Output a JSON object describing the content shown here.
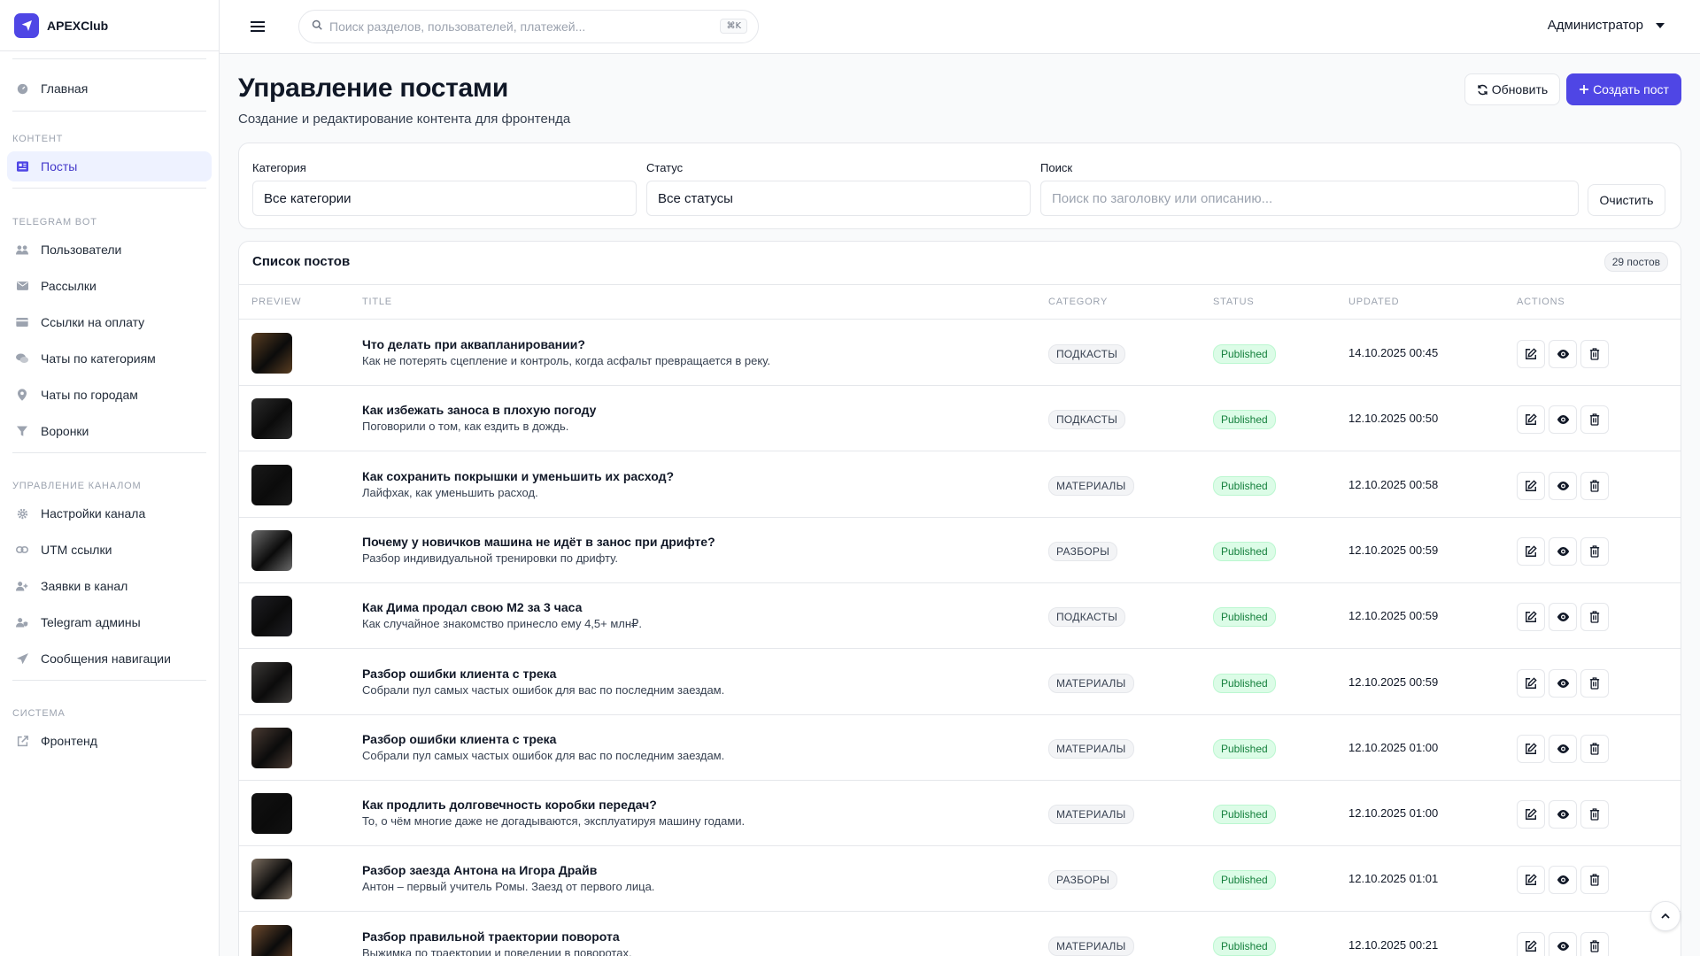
{
  "brand": {
    "name": "APEXClub",
    "icon": "rocket-icon",
    "accent": "#4f46e5"
  },
  "sidebar": {
    "home": {
      "label": "Главная",
      "icon": "dashboard-icon"
    },
    "sections": [
      {
        "title": "Контент",
        "items": [
          {
            "label": "Посты",
            "icon": "posts-icon",
            "active": true
          }
        ]
      },
      {
        "title": "Telegram Bot",
        "items": [
          {
            "label": "Пользователи",
            "icon": "users-icon"
          },
          {
            "label": "Рассылки",
            "icon": "mail-icon"
          },
          {
            "label": "Ссылки на оплату",
            "icon": "credit-card-icon"
          },
          {
            "label": "Чаты по категориям",
            "icon": "chats-icon"
          },
          {
            "label": "Чаты по городам",
            "icon": "location-pin-icon"
          },
          {
            "label": "Воронки",
            "icon": "funnel-icon"
          }
        ]
      },
      {
        "title": "Управление каналом",
        "items": [
          {
            "label": "Настройки канала",
            "icon": "gear-icon"
          },
          {
            "label": "UTM ссылки",
            "icon": "link-icon"
          },
          {
            "label": "Заявки в канал",
            "icon": "user-plus-icon"
          },
          {
            "label": "Telegram админы",
            "icon": "user-shield-icon"
          },
          {
            "label": "Сообщения навигации",
            "icon": "send-icon"
          }
        ]
      },
      {
        "title": "Система",
        "items": [
          {
            "label": "Фронтенд",
            "icon": "external-link-icon"
          }
        ]
      }
    ]
  },
  "topbar": {
    "search_placeholder": "Поиск разделов, пользователей, платежей...",
    "shortcut": "⌘K",
    "user_label": "Администратор"
  },
  "page": {
    "title": "Управление постами",
    "subtitle": "Создание и редактирование контента для фронтенда",
    "refresh_label": "Обновить",
    "create_label": "Создать пост"
  },
  "filters": {
    "category_label": "Категория",
    "category_value": "Все категории",
    "status_label": "Статус",
    "status_value": "Все статусы",
    "search_label": "Поиск",
    "search_placeholder": "Поиск по заголовку или описанию...",
    "clear_label": "Очистить"
  },
  "list": {
    "title": "Список постов",
    "count": "29 постов",
    "columns": [
      "Preview",
      "Title",
      "Category",
      "Status",
      "Updated",
      "Actions"
    ],
    "rows": [
      {
        "title": "Что делать при аквапланировании?",
        "description": "Как не потерять сцепление и контроль, когда асфальт превращается в реку.",
        "category": "ПОДКАСТЫ",
        "status": "Published",
        "updated": "14.10.2025 00:45",
        "thumb_color": "#5a3e22"
      },
      {
        "title": "Как избежать заноса в плохую погоду",
        "description": "Поговорили о том, как ездить в дождь.",
        "category": "ПОДКАСТЫ",
        "status": "Published",
        "updated": "12.10.2025 00:50",
        "thumb_color": "#2b2b2b"
      },
      {
        "title": "Как сохранить покрышки и уменьшить их расход?",
        "description": "Лайфхак, как уменьшить расход.",
        "category": "МАТЕРИАЛЫ",
        "status": "Published",
        "updated": "12.10.2025 00:58",
        "thumb_color": "#1a1a1a"
      },
      {
        "title": "Почему у новичков машина не идёт в занос при дрифте?",
        "description": "Разбор индивидуальной тренировки по дрифту.",
        "category": "РАЗБОРЫ",
        "status": "Published",
        "updated": "12.10.2025 00:59",
        "thumb_color": "#6b6b6b"
      },
      {
        "title": "Как Дима продал свою M2 за 3 часа",
        "description": "Как случайное знакомство принесло ему 4,5+ млн₽.",
        "category": "ПОДКАСТЫ",
        "status": "Published",
        "updated": "12.10.2025 00:59",
        "thumb_color": "#1f1f24"
      },
      {
        "title": "Разбор ошибки клиента с трека",
        "description": "Собрали пул самых частых ошибок для вас по последним заездам.",
        "category": "МАТЕРИАЛЫ",
        "status": "Published",
        "updated": "12.10.2025 00:59",
        "thumb_color": "#3d3a38"
      },
      {
        "title": "Разбор ошибки клиента с трека",
        "description": "Собрали пул самых частых ошибок для вас по последним заездам.",
        "category": "МАТЕРИАЛЫ",
        "status": "Published",
        "updated": "12.10.2025 01:00",
        "thumb_color": "#4a3b33"
      },
      {
        "title": "Как продлить долговечность коробки передач?",
        "description": "То, о чём многие даже не догадываются, эксплуатируя машину годами.",
        "category": "МАТЕРИАЛЫ",
        "status": "Published",
        "updated": "12.10.2025 01:00",
        "thumb_color": "#121212"
      },
      {
        "title": "Разбор заезда Антона на Игора Драйв",
        "description": "Антон – первый учитель Ромы. Заезд от первого лица.",
        "category": "РАЗБОРЫ",
        "status": "Published",
        "updated": "12.10.2025 01:01",
        "thumb_color": "#7a6c5e"
      },
      {
        "title": "Разбор правильной траектории поворота",
        "description": "Выжимка по траектории и поведении в поворотах.",
        "category": "МАТЕРИАЛЫ",
        "status": "Published",
        "updated": "12.10.2025 00:21",
        "thumb_color": "#6e4a2e"
      }
    ]
  }
}
